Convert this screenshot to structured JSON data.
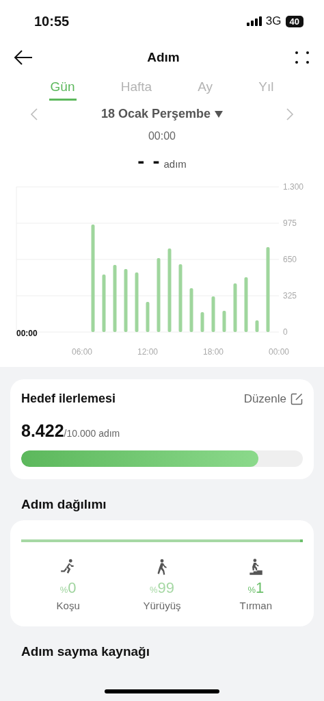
{
  "status_bar": {
    "time": "10:55",
    "network": "3G",
    "battery": "40"
  },
  "header": {
    "title": "Adım"
  },
  "tabs": [
    {
      "label": "Gün",
      "selected": true
    },
    {
      "label": "Hafta",
      "selected": false
    },
    {
      "label": "Ay",
      "selected": false
    },
    {
      "label": "Yıl",
      "selected": false
    }
  ],
  "date": {
    "label": "18 Ocak Perşembe"
  },
  "reading": {
    "time": "00:00",
    "value": "- -",
    "unit": "adım"
  },
  "chart": {
    "selected_time": "00:00",
    "chart_data": {
      "type": "bar",
      "grid": true,
      "x": [
        7,
        8,
        9,
        10,
        11,
        12,
        13,
        14,
        15,
        16,
        17,
        18,
        19,
        20,
        21,
        22,
        23
      ],
      "values": [
        963,
        515,
        601,
        564,
        533,
        270,
        662,
        748,
        607,
        392,
        178,
        319,
        190,
        435,
        490,
        104,
        760
      ],
      "xlim": [
        0,
        24
      ],
      "ylim": [
        0,
        1300
      ],
      "xticks": [
        {
          "value": 6,
          "label": "06:00"
        },
        {
          "value": 12,
          "label": "12:00"
        },
        {
          "value": 18,
          "label": "18:00"
        },
        {
          "value": 24,
          "label": "00:00"
        }
      ],
      "yticks": [
        0,
        325,
        650,
        975,
        {
          "value": 1300,
          "label": "1.300"
        }
      ]
    }
  },
  "goal": {
    "title": "Hedef ilerlemesi",
    "edit": "Düzenle",
    "current": "8.422",
    "target": "/10.000 adım",
    "level": 0.8422
  },
  "distribution": {
    "title": "Adım dağılımı",
    "items": [
      {
        "kind": "run",
        "percent_sign": "%",
        "value": "0",
        "label": "Koşu",
        "color": "#9fd49e"
      },
      {
        "kind": "walk",
        "percent_sign": "%",
        "value": "99",
        "label": "Yürüyüş",
        "color": "#a6d8a4"
      },
      {
        "kind": "climb",
        "percent_sign": "%",
        "value": "1",
        "label": "Tırman",
        "color": "#6bbf6a"
      }
    ]
  },
  "source": {
    "title": "Adım sayma kaynağı"
  }
}
